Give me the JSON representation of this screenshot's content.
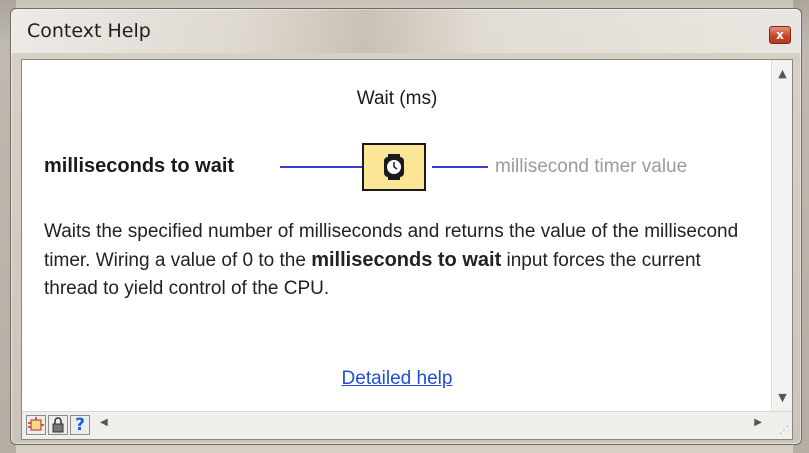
{
  "window": {
    "title": "Context Help",
    "close_label": "x"
  },
  "help": {
    "vi_name": "Wait (ms)",
    "input_terminal": "milliseconds to wait",
    "output_terminal": "millisecond timer value",
    "description_part1": "Waits the specified number of milliseconds and returns the value of the millisecond timer. Wiring a value of 0 to the",
    "description_bold": "milliseconds to wait",
    "description_part2": "input forces the current thread to yield control of the CPU.",
    "link_label": "Detailed help"
  },
  "scrollbar": {
    "up_arrow": "▲",
    "down_arrow": "▼",
    "left_arrow": "◀",
    "right_arrow": "▶"
  },
  "toolbar": {
    "help_label": "?"
  },
  "colors": {
    "wire": "#3b3bd6",
    "icon_fill": "#fbe596",
    "link": "#1f4fd8",
    "output_text": "#9b9b9b"
  }
}
